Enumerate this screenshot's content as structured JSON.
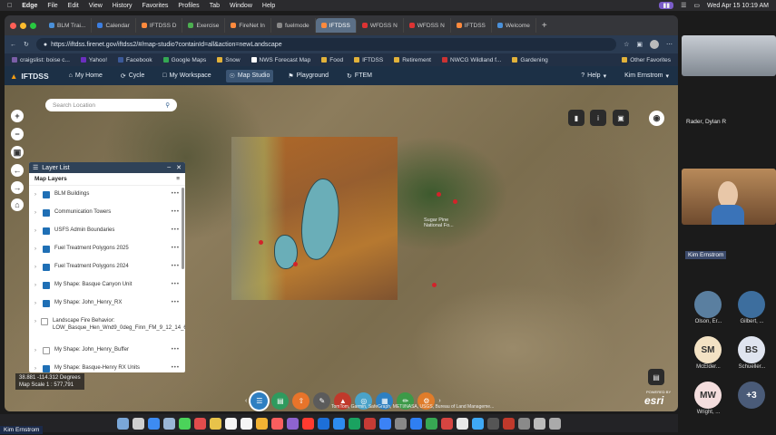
{
  "macbar": {
    "app": "Edge",
    "menus": [
      "File",
      "Edit",
      "View",
      "History",
      "Favorites",
      "Profiles",
      "Tab",
      "Window",
      "Help"
    ],
    "clock": "Wed Apr 15  10:19 AM"
  },
  "tabs": [
    {
      "label": "BLM Trai..."
    },
    {
      "label": "Calendar"
    },
    {
      "label": "IFTDSS D"
    },
    {
      "label": "Exercise"
    },
    {
      "label": "FireNet In"
    },
    {
      "label": "fuelmode"
    },
    {
      "label": "IFTDSS",
      "active": true
    },
    {
      "label": "WFDSS N"
    },
    {
      "label": "WFDSS N"
    },
    {
      "label": "IFTDSS"
    },
    {
      "label": "Welcome"
    }
  ],
  "url": "https://iftdss.firenet.gov/iftdss2/#/map-studio?containId=all&action=newLandscape",
  "favorites": [
    "craigslist: boise c...",
    "Yahoo!",
    "Facebook",
    "Google Maps",
    "Snow",
    "NWS Forecast Map",
    "Food",
    "IFTDSS",
    "Retirement",
    "NWCG Wildland f...",
    "Gardening"
  ],
  "favorites_other": "Other Favorites",
  "appnav": {
    "logo": "IFTDSS",
    "items": [
      "My Home",
      "Cycle",
      "My Workspace",
      "Map Studio",
      "Playground",
      "FTEM"
    ],
    "active": "Map Studio",
    "help": "Help",
    "user": "Kim Ernstrom"
  },
  "map": {
    "search_placeholder": "Search Location",
    "place_label": "Sugar Pine National Fo...",
    "coords": "38.881 -114.312 Degrees",
    "scale": "Map Scale 1 : 577,791",
    "attribution": "TomTom, Garmin, SafeGraph, METI/NASA, USGS, Bureau of Land Manageme...",
    "esri": "esri",
    "esri_small": "POWERED BY"
  },
  "layer_list": {
    "title": "Layer List",
    "subtitle": "Map Layers",
    "layers": [
      {
        "name": "BLM Buildings",
        "checked": true
      },
      {
        "name": "Communication Towers",
        "checked": true
      },
      {
        "name": "USFS Admin Boundaries",
        "checked": true
      },
      {
        "name": "Fuel Treatment Polygons 2025",
        "checked": true
      },
      {
        "name": "Fuel Treatment Polygons 2024",
        "checked": true
      },
      {
        "name": "My Shape: Basque Canyon Unit",
        "checked": true
      },
      {
        "name": "My Shape: John_Henry_RX",
        "checked": true
      },
      {
        "name": "Landscape Fire Behavior: LOW_Basque_Hen_Wnd9_0deg_Finn_FM_9_12_14_60_100",
        "checked": false
      },
      {
        "name": "My Shape: John_Henry_Buffer",
        "checked": false
      },
      {
        "name": "My Shape: Basque-Henry RX Units",
        "checked": true
      }
    ]
  },
  "participants": {
    "top_name": "Rader, Dylan R",
    "active_name": "Kim Ernstrom",
    "grid": [
      {
        "label": "Olson, Er...",
        "initials": "",
        "color": "#5a7fa0"
      },
      {
        "label": "Gilbert, ...",
        "initials": "",
        "color": "#3d6e9e"
      },
      {
        "label": "McElder...",
        "initials": "SM",
        "color": "#f3e2c4"
      },
      {
        "label": "Schueller...",
        "initials": "BS",
        "color": "#dfe4ef"
      },
      {
        "label": "Wright, ...",
        "initials": "MW",
        "color": "#f4dede"
      },
      {
        "label": "",
        "initials": "+3",
        "color": "#4a5b78"
      }
    ]
  },
  "self_name": "Kim Ernstrom"
}
